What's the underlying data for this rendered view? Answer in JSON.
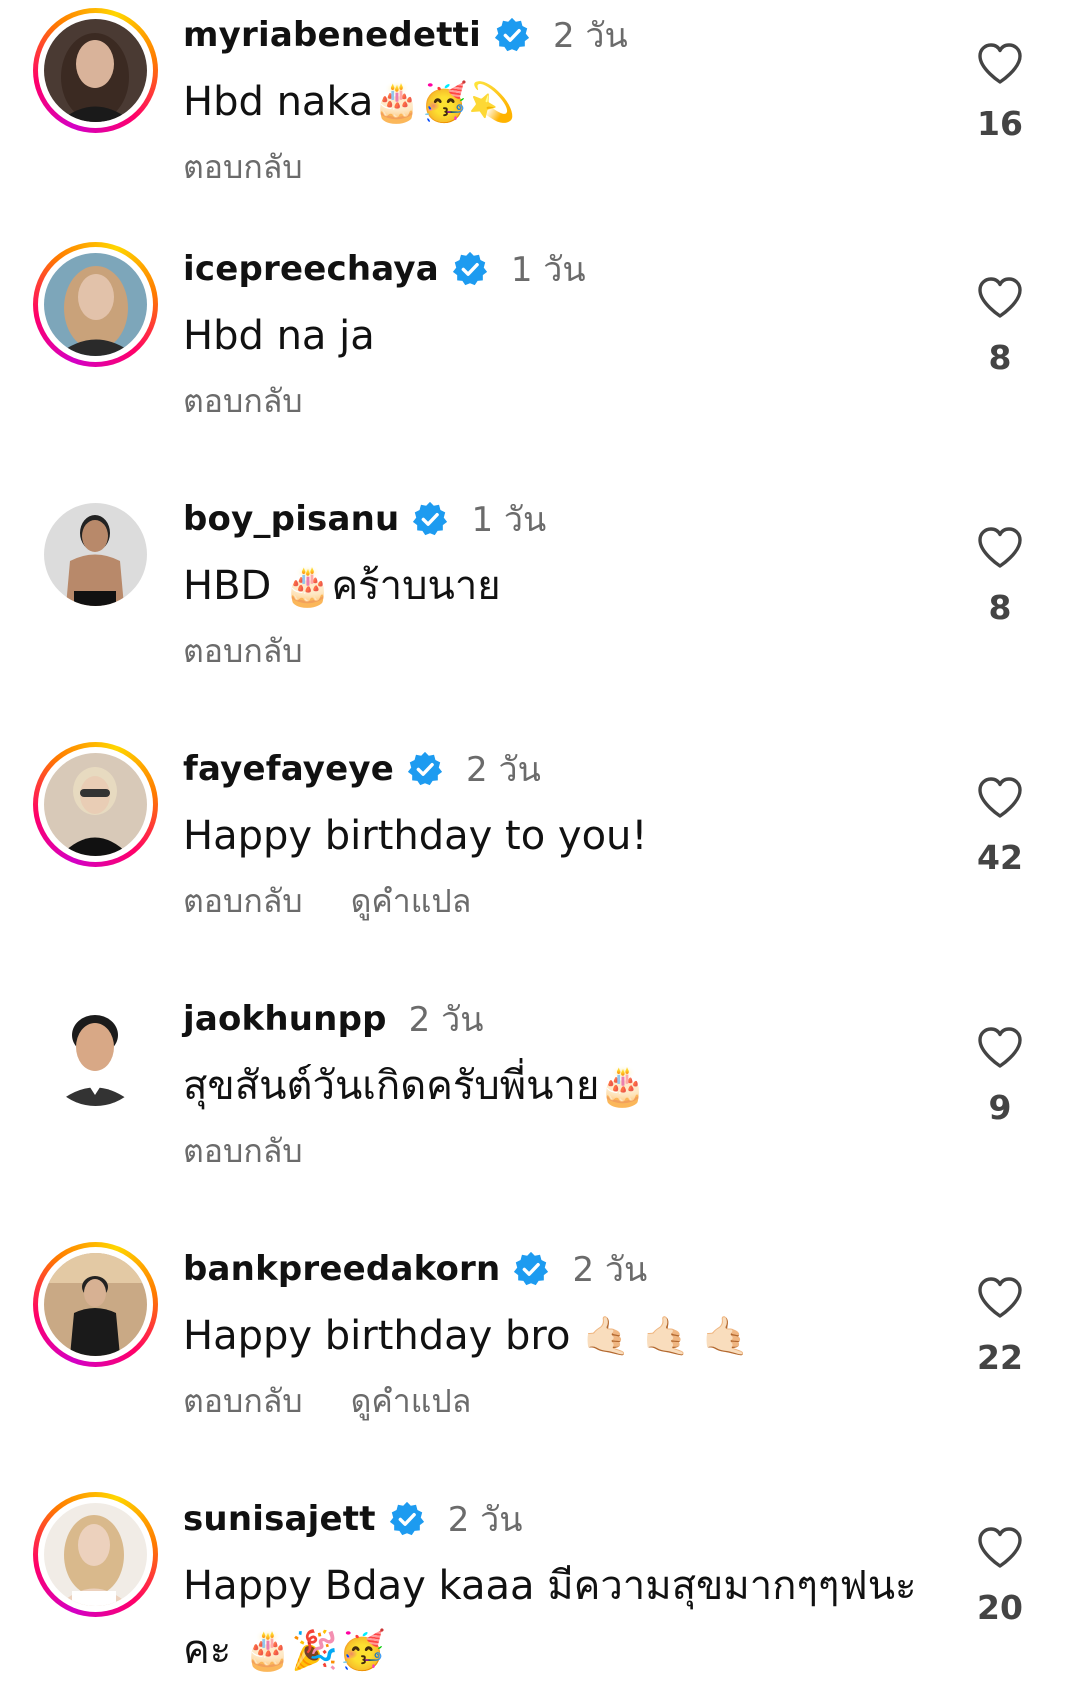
{
  "colors": {
    "verified": "#1d9bf0",
    "muted": "#6b6b6b",
    "story_ring": [
      "#d300c5",
      "#ff0069",
      "#ff7a00",
      "#ffd600"
    ]
  },
  "comments": [
    {
      "username": "myriabenedetti",
      "verified": true,
      "time": "2 วัน",
      "text": "Hbd naka",
      "emoji": "🎂🥳💫",
      "actions": [
        "ตอบกลับ"
      ],
      "likes": "16",
      "story": true,
      "avatar": {
        "bg": "#4a3a33",
        "skin": "#d9b39a",
        "hair": "#3b2a22",
        "shirt": "#1a1a1a"
      }
    },
    {
      "username": "icepreechaya",
      "verified": true,
      "time": "1 วัน",
      "text": "Hbd na ja",
      "emoji": "",
      "actions": [
        "ตอบกลับ"
      ],
      "likes": "8",
      "story": true,
      "avatar": {
        "bg": "#7da6ba",
        "skin": "#e2c2aa",
        "hair": "#c9a27a",
        "shirt": "#2a2a2a"
      }
    },
    {
      "username": "boy_pisanu",
      "verified": true,
      "time": "1 วัน",
      "text": "HBD ",
      "emoji": "🎂",
      "text_after": "คร้าบนาย",
      "actions": [
        "ตอบกลับ"
      ],
      "likes": "8",
      "story": false,
      "avatar": {
        "bg": "#dcdcdc",
        "skin": "#b8896a",
        "hair": "#222222",
        "shirt": "#111111"
      }
    },
    {
      "username": "fayefayeye",
      "verified": true,
      "time": "2 วัน",
      "text": "Happy birthday to you!",
      "emoji": "",
      "actions": [
        "ตอบกลับ",
        "ดูคำแปล"
      ],
      "likes": "42",
      "story": true,
      "avatar": {
        "bg": "#d8c9b8",
        "skin": "#e9cdb5",
        "hair": "#e7dac0",
        "shirt": "#111111"
      }
    },
    {
      "username": "jaokhunpp",
      "verified": false,
      "time": "2 วัน",
      "text": "สุขสันต์วันเกิดครับพี่นาย",
      "emoji": "🎂",
      "actions": [
        "ตอบกลับ"
      ],
      "likes": "9",
      "story": false,
      "avatar": {
        "bg": "#ffffff",
        "skin": "#d8a886",
        "hair": "#1b1b1b",
        "shirt": "#333333"
      }
    },
    {
      "username": "bankpreedakorn",
      "verified": true,
      "time": "2 วัน",
      "text": "Happy birthday bro ",
      "emoji": "🤙🏻 🤙🏻 🤙🏻",
      "actions": [
        "ตอบกลับ",
        "ดูคำแปล"
      ],
      "likes": "22",
      "story": true,
      "avatar": {
        "bg": "#c9a985",
        "skin": "#d7b193",
        "hair": "#222222",
        "shirt": "#1a1a1a"
      }
    },
    {
      "username": "sunisajett",
      "verified": true,
      "time": "2 วัน",
      "text": "Happy Bday kaaa มีความสุขมากๆๆฟนะ",
      "text_line2": "คะ ",
      "emoji": "🎂🎉🥳",
      "actions": [],
      "likes": "20",
      "story": true,
      "avatar": {
        "bg": "#f1ece6",
        "skin": "#ecd1bd",
        "hair": "#d9b98c",
        "shirt": "#ffffff"
      }
    }
  ]
}
